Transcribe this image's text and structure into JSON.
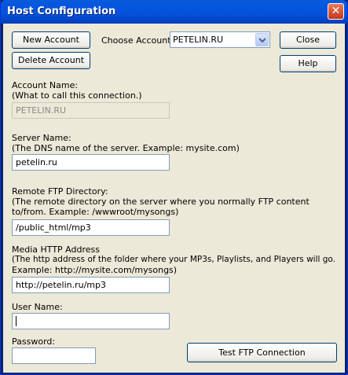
{
  "window": {
    "title": "Host Configuration",
    "close_glyph": "✕"
  },
  "toolbar": {
    "new_account": "New Account",
    "delete_account": "Delete Account",
    "choose_account_label": "Choose Account:",
    "choose_account_value": "PETELIN.RU",
    "close": "Close",
    "help": "Help"
  },
  "account_name": {
    "label": "Account Name:",
    "hint": "(What to call this connection.)",
    "value": "PETELIN.RU"
  },
  "server_name": {
    "label": "Server Name:",
    "hint": "(The DNS name of the server.  Example: mysite.com)",
    "value": "petelin.ru"
  },
  "remote_dir": {
    "label": "Remote FTP Directory:",
    "hint1": "(The remote directory on the server where you normally FTP content",
    "hint2": "to/from. Example: /wwwroot/mysongs)",
    "value": "/public_html/mp3"
  },
  "media_http": {
    "label": "Media HTTP Address",
    "hint1": "(The http address of the folder where your MP3s, Playlists, and Players will go.",
    "hint2": "Example: http://mysite.com/mysongs)",
    "value": "http://petelin.ru/mp3"
  },
  "user_name": {
    "label": "User Name:",
    "value": ""
  },
  "password": {
    "label": "Password:",
    "value": ""
  },
  "test_ftp": "Test FTP Connection"
}
